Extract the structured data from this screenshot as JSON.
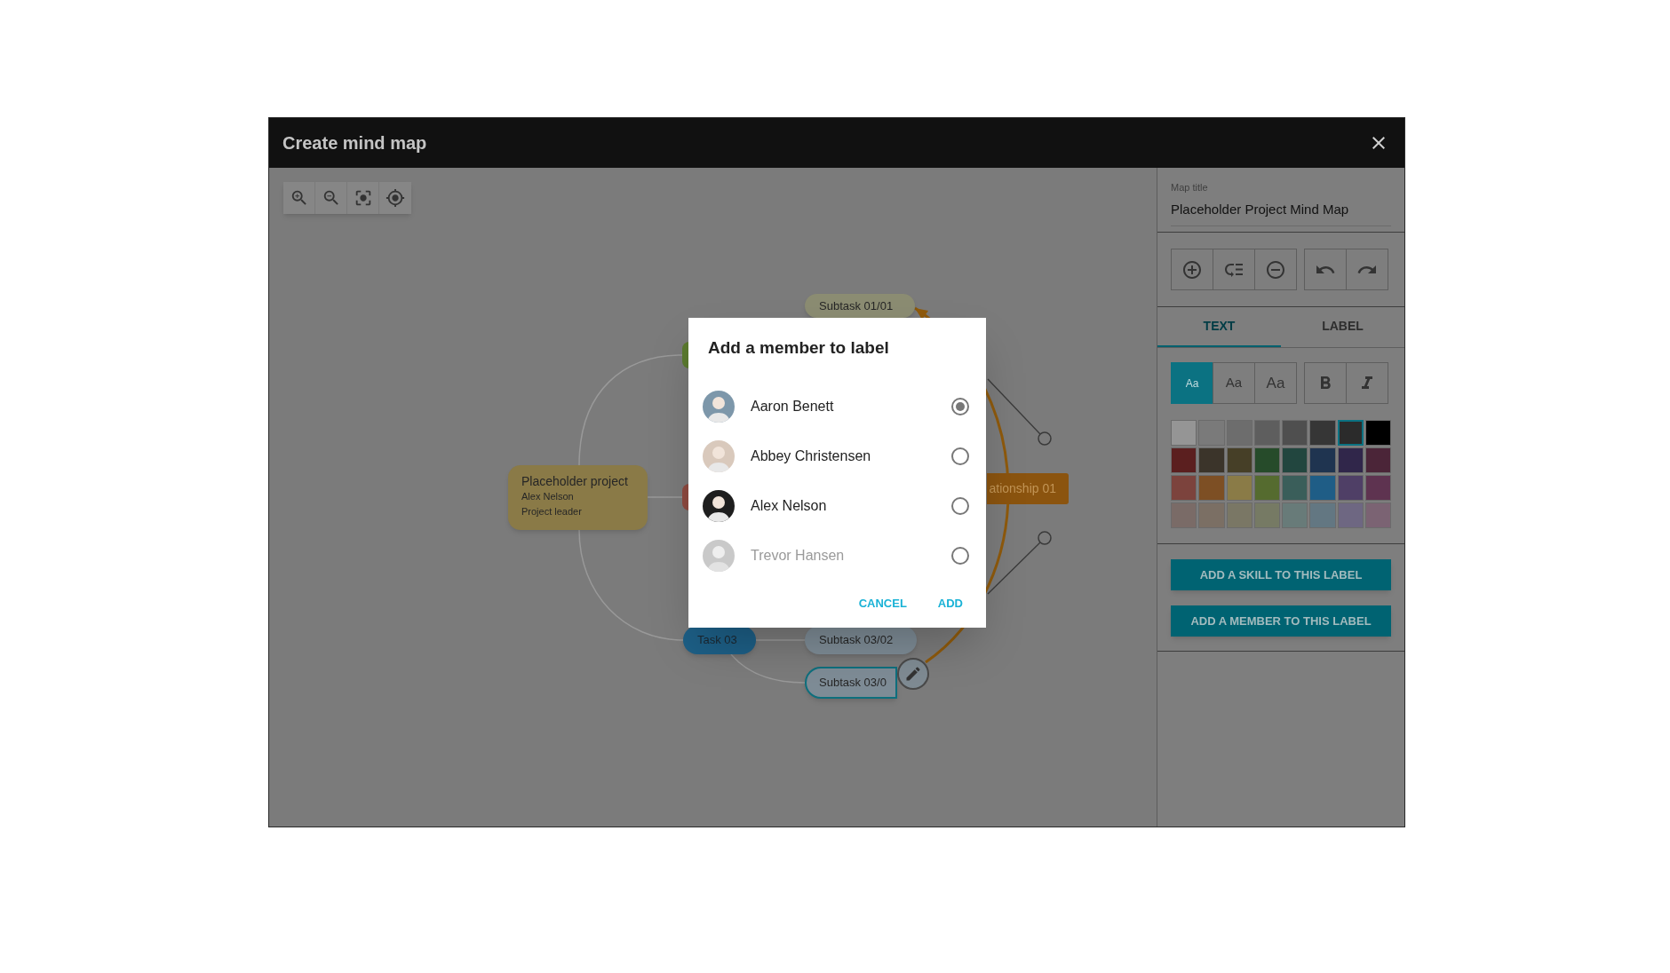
{
  "window": {
    "title": "Create mind map"
  },
  "mind_map": {
    "nodes": [
      {
        "kind": "root",
        "title": "Placeholder project",
        "details": [
          "Alex Nelson",
          "Project leader"
        ],
        "color": "#8a7a47",
        "selected": false
      },
      {
        "kind": "subtask",
        "label": "Subtask 01/01",
        "color": "#8b8c72",
        "selected": false
      },
      {
        "kind": "stub",
        "color": "#5b7a2f",
        "selected": false
      },
      {
        "kind": "stub",
        "color": "#8f4a40",
        "selected": false
      },
      {
        "kind": "task",
        "label": "Task 03",
        "color": "#1d5f86",
        "selected": false
      },
      {
        "kind": "subtask",
        "label": "Subtask 03/02",
        "color": "#7e8c96",
        "selected": false
      },
      {
        "kind": "subtask",
        "label": "Subtask 03/0",
        "color": "#7e8c96",
        "selected": true
      }
    ],
    "relationship": {
      "label": "ationship 01"
    }
  },
  "dialog": {
    "title": "Add a member to label",
    "members": [
      {
        "name": "Aaron Benett",
        "selected": true,
        "disabled": false
      },
      {
        "name": "Abbey Christensen",
        "selected": false,
        "disabled": false
      },
      {
        "name": "Alex Nelson",
        "selected": false,
        "disabled": false
      },
      {
        "name": "Trevor Hansen",
        "selected": false,
        "disabled": true
      }
    ],
    "buttons": [
      "CANCEL",
      "ADD"
    ]
  },
  "panel": {
    "map_title": {
      "label": "Map title",
      "value": "Placeholder Project Mind Map"
    },
    "tabs": [
      {
        "label": "TEXT",
        "selected": true
      },
      {
        "label": "LABEL",
        "selected": false
      }
    ],
    "text_styles": [
      {
        "kind": "small",
        "label": "Aa",
        "selected": true
      },
      {
        "kind": "medium",
        "label": "Aa",
        "selected": false
      },
      {
        "kind": "large",
        "label": "Aa",
        "selected": false
      }
    ],
    "swatches": [
      {
        "color": "#959595",
        "selected": false
      },
      {
        "color": "#7a7a7a",
        "selected": false
      },
      {
        "color": "#6d6d6d",
        "selected": false
      },
      {
        "color": "#5e5e5e",
        "selected": false
      },
      {
        "color": "#4f4f4f",
        "selected": false
      },
      {
        "color": "#363636",
        "selected": false
      },
      {
        "color": "#2b2b2b",
        "selected": true
      },
      {
        "color": "#000000",
        "selected": false
      },
      {
        "color": "#5b1f1f",
        "selected": false
      },
      {
        "color": "#3b342a",
        "selected": false
      },
      {
        "color": "#463f27",
        "selected": false
      },
      {
        "color": "#264b2a",
        "selected": false
      },
      {
        "color": "#22463f",
        "selected": false
      },
      {
        "color": "#1f3450",
        "selected": false
      },
      {
        "color": "#30264a",
        "selected": false
      },
      {
        "color": "#4b2538",
        "selected": false
      },
      {
        "color": "#7c433d",
        "selected": false
      },
      {
        "color": "#7d4f24",
        "selected": false
      },
      {
        "color": "#8a7b47",
        "selected": false
      },
      {
        "color": "#556b2f",
        "selected": false
      },
      {
        "color": "#3a5e5a",
        "selected": false
      },
      {
        "color": "#1f5d86",
        "selected": false
      },
      {
        "color": "#4f3f66",
        "selected": false
      },
      {
        "color": "#5e3350",
        "selected": false
      },
      {
        "color": "#7a6b67",
        "selected": false
      },
      {
        "color": "#7b6f64",
        "selected": false
      },
      {
        "color": "#7a7765",
        "selected": false
      },
      {
        "color": "#767a64",
        "selected": false
      },
      {
        "color": "#687b79",
        "selected": false
      },
      {
        "color": "#637782",
        "selected": false
      },
      {
        "color": "#6e6782",
        "selected": false
      },
      {
        "color": "#7b6373",
        "selected": false
      }
    ],
    "actions": [
      "ADD A SKILL TO THIS LABEL",
      "ADD A MEMBER TO THIS LABEL"
    ]
  }
}
